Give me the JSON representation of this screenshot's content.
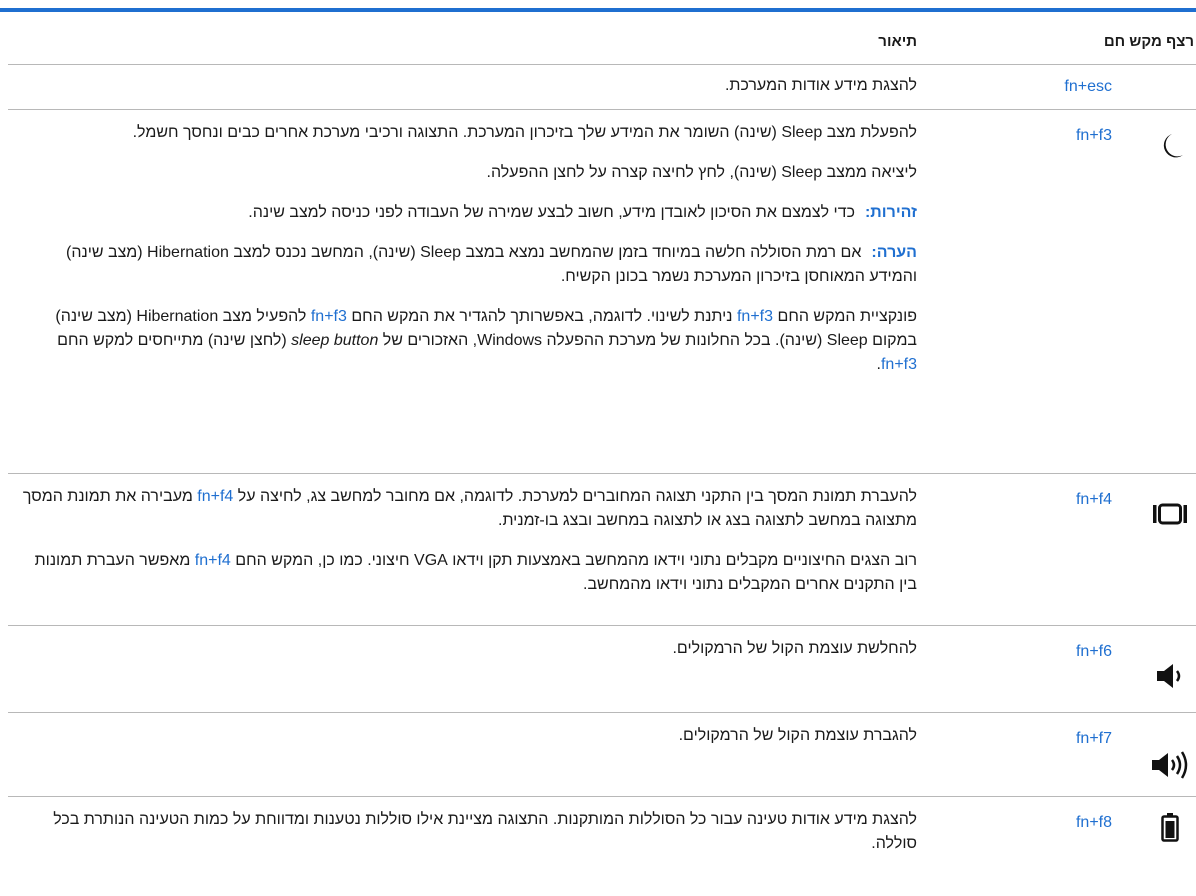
{
  "header": {
    "key_sequence": "רצף מקש חם",
    "description": "תיאור"
  },
  "rows": [
    {
      "icon": "none",
      "key": "fn+esc",
      "text": "להצגת מידע אודות המערכת."
    },
    {
      "icon": "moon-icon",
      "key": "fn+f3",
      "p1": "להפעלת מצב Sleep (שינה) השומר את המידע שלך בזיכרון המערכת. התצוגה ורכיבי מערכת אחרים כבים ונחסך חשמל.",
      "p2": "ליציאה ממצב Sleep (שינה), לחץ לחיצה קצרה על לחצן ההפעלה.",
      "caution_label": "זהירות:",
      "caution_text": "כדי לצמצם את הסיכון לאובדן מידע, חשוב לבצע שמירה של העבודה לפני כניסה למצב שינה.",
      "note_label": "הערה:",
      "note_text": "אם רמת הסוללה חלשה במיוחד בזמן שהמחשב נמצא במצב Sleep (שינה), המחשב נכנס למצב Hibernation (מצב שינה) והמידע המאוחסן בזיכרון המערכת נשמר בכונן הקשיח.",
      "p5_a": "פונקציית המקש החם ",
      "p5_link1": "fn+f3",
      "p5_b": " ניתנת לשינוי. לדוגמה, באפשרותך להגדיר את המקש החם ",
      "p5_link2": "fn+f3",
      "p5_c": " להפעיל מצב Hibernation (מצב שינה) במקום Sleep (שינה). בכל החלונות של מערכת ההפעלה Windows, האזכורים של ",
      "p5_italic": "sleep button",
      "p5_d": " (לחצן שינה) מתייחסים למקש החם ",
      "p5_link3": "fn+f3",
      "p5_e": "."
    },
    {
      "icon": "display-switch-icon",
      "key": "fn+f4",
      "p1_a": "להעברת תמונת המסך בין התקני תצוגה המחוברים למערכת. לדוגמה, אם מחובר למחשב צג, לחיצה על ",
      "p1_link": "fn+f4",
      "p1_b": " מעבירה את תמונת המסך מתצוגה במחשב לתצוגה בצג או לתצוגה במחשב ובצג בו-זמנית.",
      "p2_a": "רוב הצגים החיצוניים מקבלים נתוני וידאו מהמחשב באמצעות תקן וידאו VGA חיצוני. כמו כן, המקש החם ",
      "p2_link": "fn+f4",
      "p2_b": " מאפשר העברת תמונות בין התקנים אחרים המקבלים נתוני וידאו מהמחשב."
    },
    {
      "icon": "volume-down-icon",
      "key": "fn+f6",
      "text": "להחלשת עוצמת הקול של הרמקולים."
    },
    {
      "icon": "volume-up-icon",
      "key": "fn+f7",
      "text": "להגברת עוצמת הקול של הרמקולים."
    },
    {
      "icon": "battery-icon",
      "key": "fn+f8",
      "text": "להצגת מידע אודות טעינה עבור כל הסוללות המותקנות. התצוגה מציינת אילו סוללות נטענות ומדווחת על כמות הטעינה הנותרת בכל סוללה."
    }
  ],
  "colors": {
    "accent": "#1f6fd0",
    "divider": "#b8b8b8",
    "text": "#1a1a1a"
  }
}
